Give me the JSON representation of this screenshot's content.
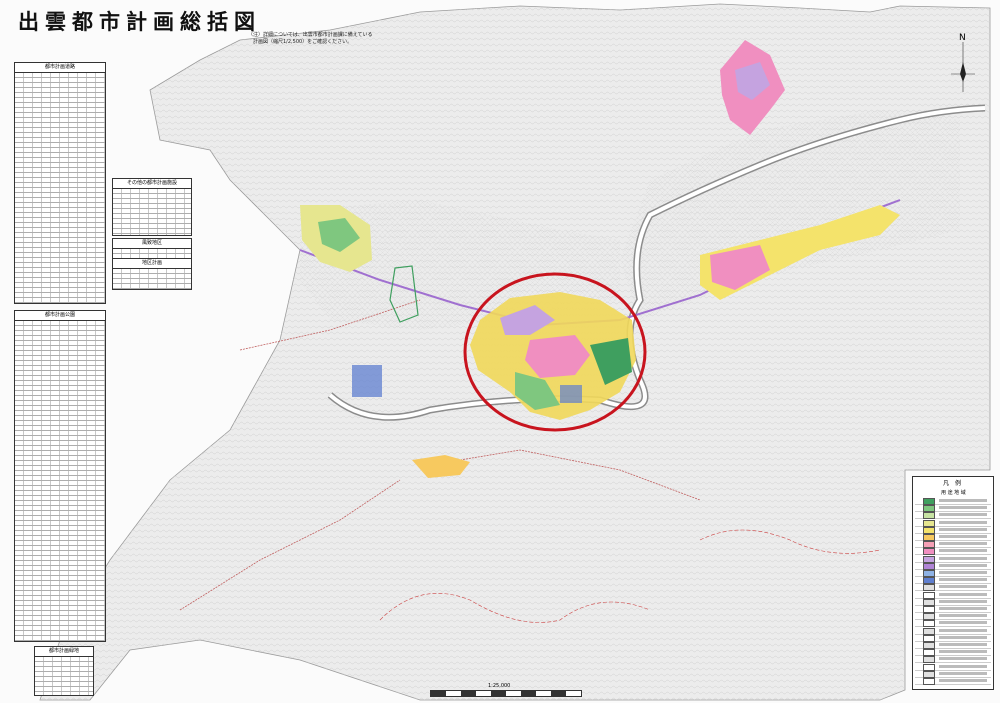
{
  "map": {
    "title": "出雲都市計画総括図",
    "note": "（注）詳細については、出雲市都市計画課に備えている\n　計画図（縮尺1/2,500）をご確認ください。",
    "compass_label": "N",
    "scale_label": "1:25,000",
    "highlight_color": "#c8141e",
    "tables": {
      "roads": "都市計画道路",
      "parks": "都市計画公園",
      "others": "その他の都市計画施設",
      "scenic": "風致地区",
      "district": "地区計画",
      "green": "都市計画緑地"
    },
    "legend": {
      "title": "凡　例",
      "header": "用 途 地 域"
    },
    "zone_colors": [
      "#3f9f5f",
      "#7fc77f",
      "#c7e3a3",
      "#e6e68f",
      "#f4e36b",
      "#f7c95f",
      "#f59fb5",
      "#f08fc0",
      "#c5a3e0",
      "#b084d6",
      "#8fb3e6",
      "#5f7fd0"
    ]
  }
}
